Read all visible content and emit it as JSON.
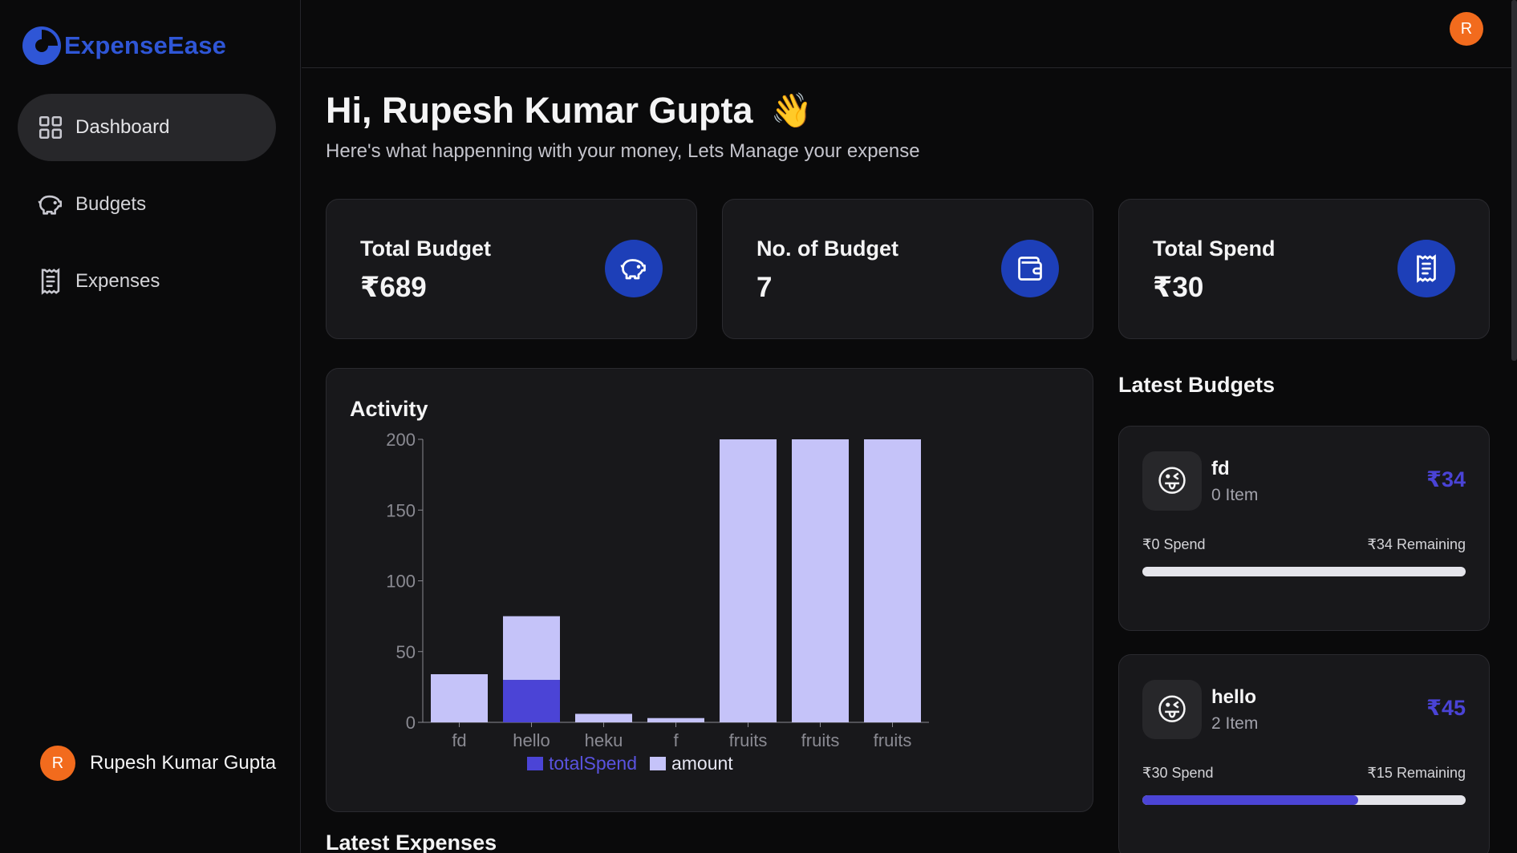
{
  "app": {
    "name": "ExpenseEase",
    "accent": "#2f56d6"
  },
  "sidebar": {
    "items": [
      {
        "label": "Dashboard",
        "icon": "grid-icon",
        "active": true
      },
      {
        "label": "Budgets",
        "icon": "piggy-bank-icon",
        "active": false
      },
      {
        "label": "Expenses",
        "icon": "receipt-icon",
        "active": false
      }
    ],
    "user": {
      "initial": "R",
      "name": "Rupesh Kumar Gupta"
    }
  },
  "header": {
    "avatar_initial": "R"
  },
  "greeting": {
    "title": "Hi, Rupesh Kumar Gupta",
    "emoji": "👋",
    "subtitle": "Here's what happenning with your money, Lets Manage your expense"
  },
  "stats": [
    {
      "label": "Total Budget",
      "value": "₹689",
      "icon": "piggy-bank-icon"
    },
    {
      "label": "No. of Budget",
      "value": "7",
      "icon": "wallet-icon"
    },
    {
      "label": "Total Spend",
      "value": "₹30",
      "icon": "receipt-icon"
    }
  ],
  "activity": {
    "title": "Activity"
  },
  "chart_data": {
    "type": "bar",
    "stacked": true,
    "categories": [
      "fd",
      "hello",
      "heku",
      "f",
      "fruits",
      "fruits",
      "fruits"
    ],
    "series": [
      {
        "name": "totalSpend",
        "color": "#4b44d6",
        "values": [
          0,
          30,
          0,
          0,
          0,
          0,
          0
        ]
      },
      {
        "name": "amount",
        "color": "#c5c3f9",
        "values": [
          34,
          45,
          6,
          3,
          200,
          200,
          200
        ]
      }
    ],
    "ylim": [
      0,
      200
    ],
    "yticks": [
      0,
      50,
      100,
      150,
      200
    ],
    "legend": "bottom"
  },
  "latest_expenses": {
    "title": "Latest Expenses"
  },
  "latest_budgets": {
    "title": "Latest Budgets",
    "items": [
      {
        "emoji": "😜",
        "name": "fd",
        "items": "0 Item",
        "amount": "₹34",
        "spend": "₹0 Spend",
        "remaining": "₹34 Remaining",
        "progress": 0
      },
      {
        "emoji": "😜",
        "name": "hello",
        "items": "2 Item",
        "amount": "₹45",
        "spend": "₹30 Spend",
        "remaining": "₹15 Remaining",
        "progress": 0.667
      }
    ]
  }
}
